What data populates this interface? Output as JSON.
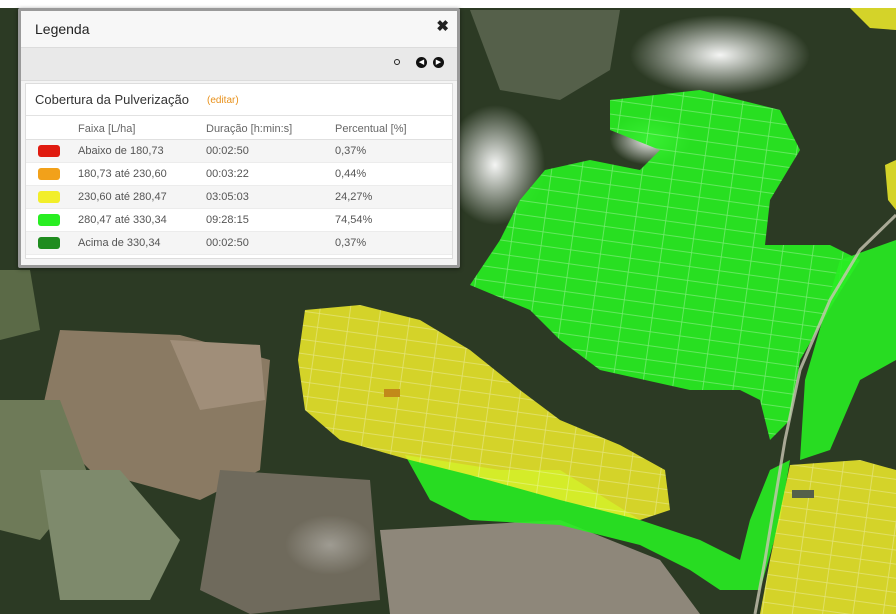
{
  "legend": {
    "title": "Legenda",
    "close_icon": "close-icon",
    "nav": {
      "dot_icon": "dot-icon",
      "prev_icon": "chevron-left-icon",
      "next_icon": "chevron-right-icon"
    },
    "panel_title": "Cobertura da Pulverização",
    "edit_link": "(editar)",
    "columns": [
      "Faixa [L/ha]",
      "Duração [h:min:s]",
      "Percentual [%]"
    ],
    "rows": [
      {
        "color": "#e01b10",
        "range": "Abaixo de 180,73",
        "duration": "00:02:50",
        "percent": "0,37%"
      },
      {
        "color": "#f2a11a",
        "range": "180,73 até 230,60",
        "duration": "00:03:22",
        "percent": "0,44%"
      },
      {
        "color": "#f2ee2a",
        "range": "230,60 até 280,47",
        "duration": "03:05:03",
        "percent": "24,27%"
      },
      {
        "color": "#28ee22",
        "range": "280,47 até 330,34",
        "duration": "09:28:15",
        "percent": "74,54%"
      },
      {
        "color": "#1f8c1f",
        "range": "Acima de 330,34",
        "duration": "00:02:50",
        "percent": "0,37%"
      }
    ]
  }
}
